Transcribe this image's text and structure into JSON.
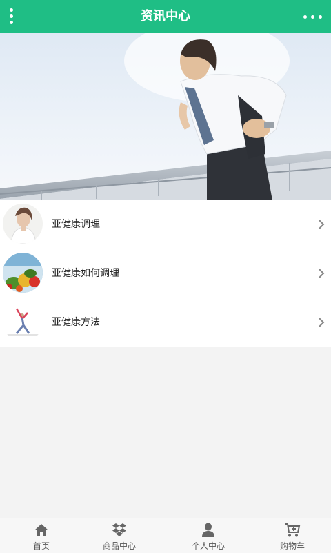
{
  "header": {
    "title": "资讯中心",
    "menu_icon": "vertical-dots-icon",
    "more_icon": "horizontal-dots-icon",
    "bg_color": "#1fbe85"
  },
  "banner": {
    "image": "man-running-photo"
  },
  "articles": [
    {
      "title": "亚健康调理",
      "thumb": "woman-portrait-photo"
    },
    {
      "title": "亚健康如何调理",
      "thumb": "vegetables-photo"
    },
    {
      "title": "亚健康方法",
      "thumb": "stretching-woman-photo"
    }
  ],
  "tabbar": [
    {
      "label": "首页",
      "icon": "home-icon"
    },
    {
      "label": "商品中心",
      "icon": "dropbox-icon"
    },
    {
      "label": "个人中心",
      "icon": "user-icon"
    },
    {
      "label": "购物车",
      "icon": "cart-add-icon"
    }
  ]
}
